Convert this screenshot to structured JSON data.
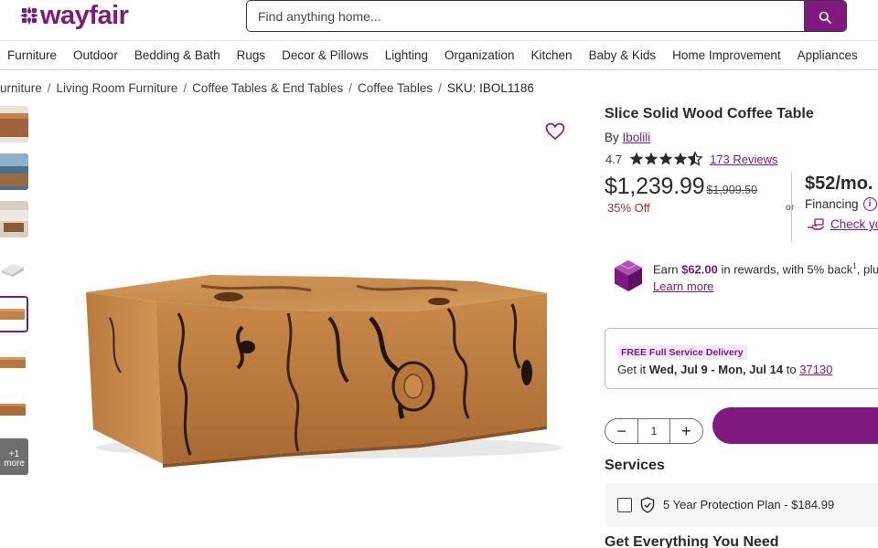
{
  "brand": {
    "logo_text": "wayfair",
    "accent_color": "#7f187f"
  },
  "search": {
    "placeholder": "Find anything home...",
    "icon": "search-icon"
  },
  "nav": {
    "items": [
      "Furniture",
      "Outdoor",
      "Bedding & Bath",
      "Rugs",
      "Decor & Pillows",
      "Lighting",
      "Organization",
      "Kitchen",
      "Baby & Kids",
      "Home Improvement",
      "Appliances"
    ]
  },
  "breadcrumb": {
    "items": [
      "urniture",
      "Living Room Furniture",
      "Coffee Tables & End Tables",
      "Coffee Tables"
    ],
    "separator": "/",
    "sku": "SKU: IBOL1186"
  },
  "gallery": {
    "thumbnail_count": 8,
    "active_index": 4,
    "more_label_1": "+1",
    "more_label_2": "more"
  },
  "product": {
    "title": "Slice Solid Wood Coffee Table",
    "by_prefix": "By",
    "brand": "Ibolili",
    "rating": "4.7",
    "stars": 4.5,
    "reviews": "173 Reviews",
    "price": "$1,239.99",
    "original_price": "$1,909.50",
    "discount": "35% Off",
    "or": "or",
    "monthly": "$52/mo.",
    "financing": "Financing",
    "financing_info_icon": "i",
    "check_label": "Check yo"
  },
  "rewards": {
    "prefix": "Earn",
    "amount": "$62.00",
    "suffix": "in rewards, with 5% back",
    "footnote": "1",
    "tail": ", plu",
    "learn_more": "Learn more"
  },
  "delivery": {
    "badge": "FREE Full Service Delivery",
    "get_it": "Get it",
    "dates": "Wed, Jul 9 - Mon, Jul 14",
    "to": "to",
    "zip": "37130"
  },
  "quantity": {
    "minus": "−",
    "value": "1",
    "plus": "+"
  },
  "services": {
    "heading": "Services",
    "protection_plan": "5 Year Protection Plan - $184.99"
  },
  "bundle": {
    "heading": "Get Everything You Need"
  }
}
